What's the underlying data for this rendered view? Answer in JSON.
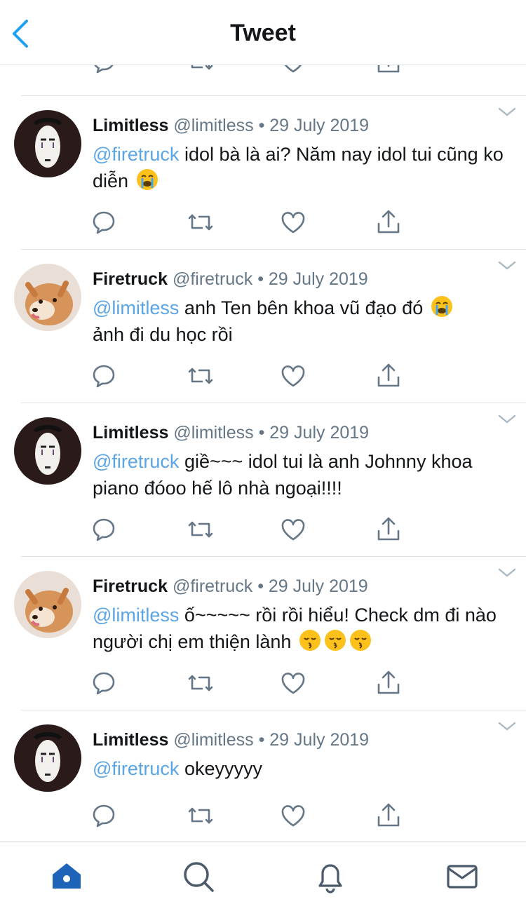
{
  "header": {
    "title": "Tweet",
    "back_icon": "chevron-left-icon"
  },
  "colors": {
    "accent": "#1da1f2",
    "mention": "#5aa5e6",
    "text": "#14171a",
    "secondary": "#657786",
    "divider": "#dfe3e7"
  },
  "tweets": [
    {
      "name": "Limitless",
      "handle": "@limitless",
      "date": "29 July 2019",
      "mention": "@firetruck",
      "body": " idol bà là ai? Năm nay idol tui cũng ko diễn ",
      "emoji": [
        "loudly-crying-face"
      ],
      "avatar": "mask-avatar"
    },
    {
      "name": "Firetruck",
      "handle": "@firetruck",
      "date": "29 July 2019",
      "mention": "@limitless",
      "body": " anh Ten bên khoa vũ đạo đó ",
      "body2": "ảnh đi du học rồi",
      "emoji": [
        "loudly-crying-face"
      ],
      "avatar": "dog-avatar"
    },
    {
      "name": "Limitless",
      "handle": "@limitless",
      "date": "29 July 2019",
      "mention": "@firetruck",
      "body": " giề~~~ idol tui là anh Johnny khoa piano đóoo hế lô nhà ngoại!!!!",
      "emoji": [],
      "avatar": "mask-avatar"
    },
    {
      "name": "Firetruck",
      "handle": "@firetruck",
      "date": "29 July 2019",
      "mention": "@limitless",
      "body": " ố~~~~~ rồi rồi hiểu! Check dm đi nào người chị em thiện lành ",
      "emoji": [
        "kissing-face-with-closed-eyes",
        "kissing-face-with-closed-eyes",
        "kissing-face-with-closed-eyes"
      ],
      "avatar": "dog-avatar"
    },
    {
      "name": "Limitless",
      "handle": "@limitless",
      "date": "29 July 2019",
      "mention": "@firetruck",
      "body": " okeyyyyy",
      "emoji": [],
      "avatar": "mask-avatar"
    }
  ],
  "tabbar": {
    "items": [
      "home-icon",
      "search-icon",
      "bell-icon",
      "mail-icon"
    ],
    "active": "home-icon"
  }
}
